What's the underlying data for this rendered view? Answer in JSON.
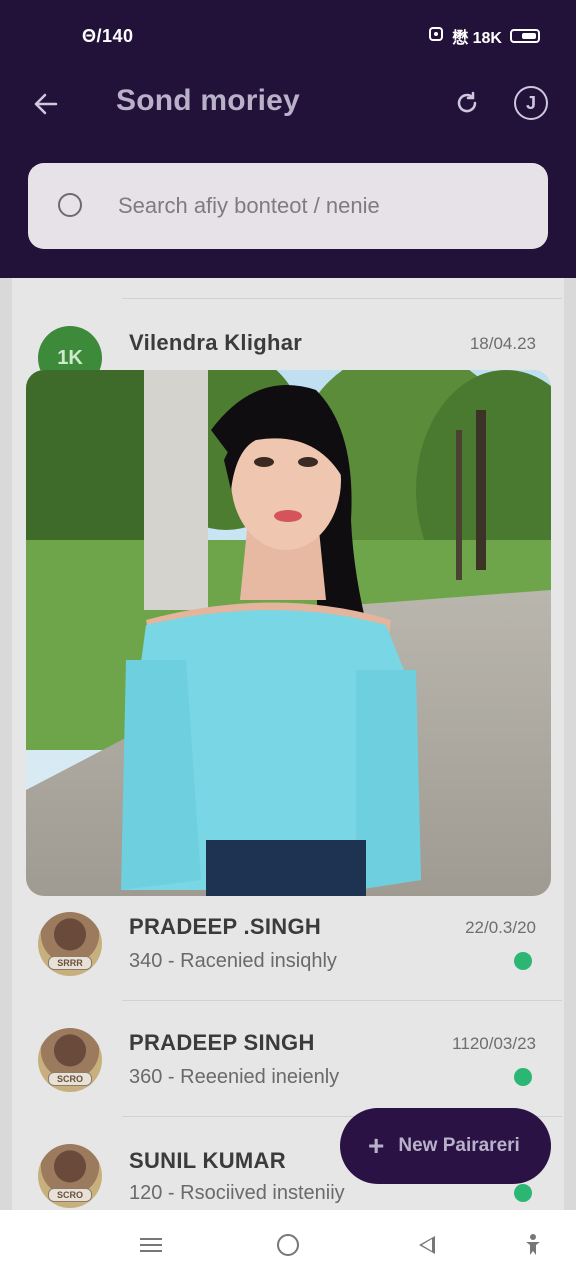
{
  "status_bar": {
    "time": "Θ/140",
    "right_text": "懋 18K",
    "icons": [
      "alarm-icon",
      "battery-icon"
    ]
  },
  "appbar": {
    "back_icon": "arrow-left-icon",
    "title": "Sond moriey",
    "icons": [
      "refresh-icon",
      "info-icon"
    ]
  },
  "search": {
    "placeholder": "Search afiy bonteot / nenie",
    "value": ""
  },
  "contacts": [
    {
      "initials": "1K",
      "name": "Vilendra  Klighar",
      "date": "18/04.23",
      "subtitle": "",
      "status": ""
    },
    {
      "avatar_tag": "SRRR",
      "name": "PRADEEP .SINGH",
      "date": "22/0.3/20",
      "subtitle": "340 - Racenied insiqhly",
      "status": "online"
    },
    {
      "avatar_tag": "SCRO",
      "name": "PRADEEP SINGH",
      "date": "1120/03/23",
      "subtitle": "360 - Reeenied ineienly",
      "status": "online"
    },
    {
      "avatar_tag": "SCRO",
      "name": "SUNIL  KUMAR",
      "date": "",
      "subtitle": "120 - Rsociived insteniiy",
      "status": "online"
    }
  ],
  "fab": {
    "icon": "plus-icon",
    "label": "New Pairareri"
  },
  "navbar": {
    "icons": [
      "menu-icon",
      "home-icon",
      "back-icon",
      "accessibility-icon"
    ]
  },
  "colors": {
    "header_bg": "#22123a",
    "fab_bg": "#2a1244",
    "status_dot": "#2bb673",
    "list_bg": "#e6e6e6"
  }
}
